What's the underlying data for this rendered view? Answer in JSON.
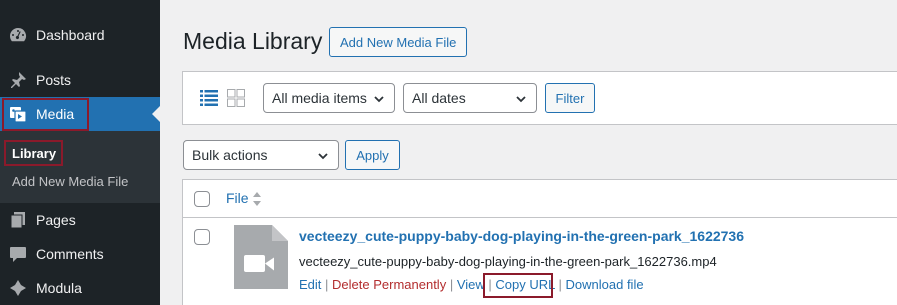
{
  "sidebar": {
    "dashboard": "Dashboard",
    "posts": "Posts",
    "media": "Media",
    "submenu": {
      "library": "Library",
      "add_new": "Add New Media File"
    },
    "pages": "Pages",
    "comments": "Comments",
    "modula": "Modula"
  },
  "header": {
    "title": "Media Library",
    "add_new_button": "Add New Media File"
  },
  "filters": {
    "type_select": "All media items",
    "date_select": "All dates",
    "filter_button": "Filter",
    "views": [
      "list-view-icon",
      "grid-view-icon"
    ]
  },
  "bulk": {
    "select": "Bulk actions",
    "apply_button": "Apply"
  },
  "table": {
    "column_file": "File",
    "rows": [
      {
        "title": "vecteezy_cute-puppy-baby-dog-playing-in-the-green-park_1622736",
        "filename": "vecteezy_cute-puppy-baby-dog-playing-in-the-green-park_1622736.mp4",
        "actions": {
          "edit": "Edit",
          "delete": "Delete Permanently",
          "view": "View",
          "copy_url": "Copy URL",
          "download": "Download file"
        },
        "thumbnail_icon": "video-icon"
      }
    ]
  },
  "colors": {
    "accent": "#2271b1",
    "sidebar": "#1d2327",
    "highlight": "#8b1a2b",
    "danger": "#b32d2e"
  }
}
